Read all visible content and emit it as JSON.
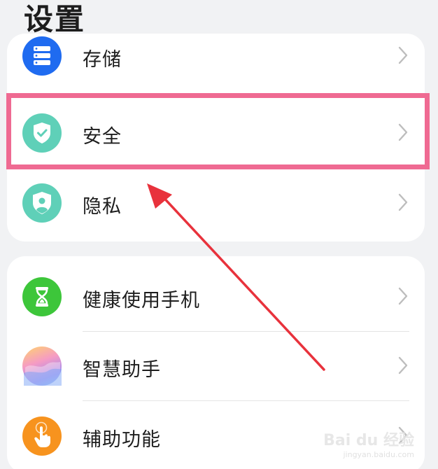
{
  "header": {
    "title": "设置"
  },
  "groups": [
    {
      "items": [
        {
          "label": "存储",
          "icon": "storage-icon",
          "color": "#1f6bf0"
        },
        {
          "label": "安全",
          "icon": "shield-check-icon",
          "color": "#5fd0b8"
        },
        {
          "label": "隐私",
          "icon": "privacy-shield-icon",
          "color": "#5fd0b8"
        }
      ]
    },
    {
      "items": [
        {
          "label": "健康使用手机",
          "icon": "hourglass-icon",
          "color": "#3dc63a"
        },
        {
          "label": "智慧助手",
          "icon": "assistant-icon",
          "color": "#c793e8"
        },
        {
          "label": "辅助功能",
          "icon": "hand-tap-icon",
          "color": "#f7931e"
        }
      ]
    }
  ],
  "annotation": {
    "highlight_color": "#ef6a92",
    "arrow_color": "#e8323c"
  },
  "watermark": {
    "brand": "Bai du 经验",
    "url": "jingyan.baidu.com"
  }
}
